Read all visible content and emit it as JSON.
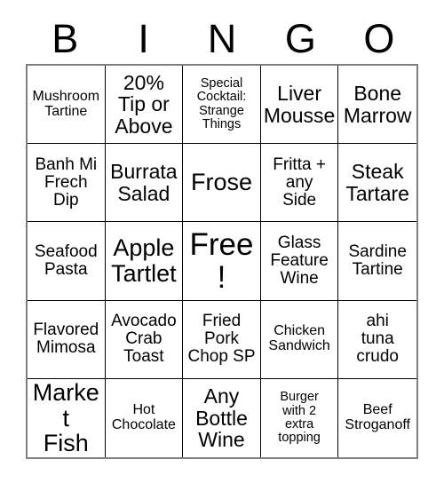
{
  "card": {
    "title": "BINGO",
    "header_letters": [
      "B",
      "I",
      "N",
      "G",
      "O"
    ],
    "grid_size": "5x5",
    "colors": {
      "background": "#ffffff",
      "text": "#000000",
      "cell_border": "#000000",
      "outer_border": "#7f7f7f"
    },
    "rows": [
      [
        {
          "text": "Mushroom\nTartine",
          "size": "sm"
        },
        {
          "text": "20%\nTip or\nAbove",
          "size": "lg"
        },
        {
          "text": "Special\nCocktail:\nStrange\nThings",
          "size": "xs"
        },
        {
          "text": "Liver\nMousse",
          "size": "lg"
        },
        {
          "text": "Bone\nMarrow",
          "size": "lg"
        }
      ],
      [
        {
          "text": "Banh Mi\nFrech\nDip",
          "size": "md"
        },
        {
          "text": "Burrata\nSalad",
          "size": "lg"
        },
        {
          "text": "Frose",
          "size": "xl"
        },
        {
          "text": "Fritta +\nany\nSide",
          "size": "md"
        },
        {
          "text": "Steak\nTartare",
          "size": "lg"
        }
      ],
      [
        {
          "text": "Seafood\nPasta",
          "size": "md"
        },
        {
          "text": "Apple\nTartlet",
          "size": "xl"
        },
        {
          "text": "Free!",
          "size": "xxl"
        },
        {
          "text": "Glass\nFeature\nWine",
          "size": "md"
        },
        {
          "text": "Sardine\nTartine",
          "size": "md"
        }
      ],
      [
        {
          "text": "Flavored\nMimosa",
          "size": "md"
        },
        {
          "text": "Avocado\nCrab\nToast",
          "size": "md"
        },
        {
          "text": "Fried\nPork\nChop SP",
          "size": "md"
        },
        {
          "text": "Chicken\nSandwich",
          "size": "sm"
        },
        {
          "text": "ahi\ntuna\ncrudo",
          "size": "md"
        }
      ],
      [
        {
          "text": "Market\nFish",
          "size": "xl"
        },
        {
          "text": "Hot\nChocolate",
          "size": "sm"
        },
        {
          "text": "Any\nBottle\nWine",
          "size": "lg"
        },
        {
          "text": "Burger\nwith 2\nextra\ntopping",
          "size": "xs"
        },
        {
          "text": "Beef\nStroganoff",
          "size": "sm"
        }
      ]
    ]
  }
}
